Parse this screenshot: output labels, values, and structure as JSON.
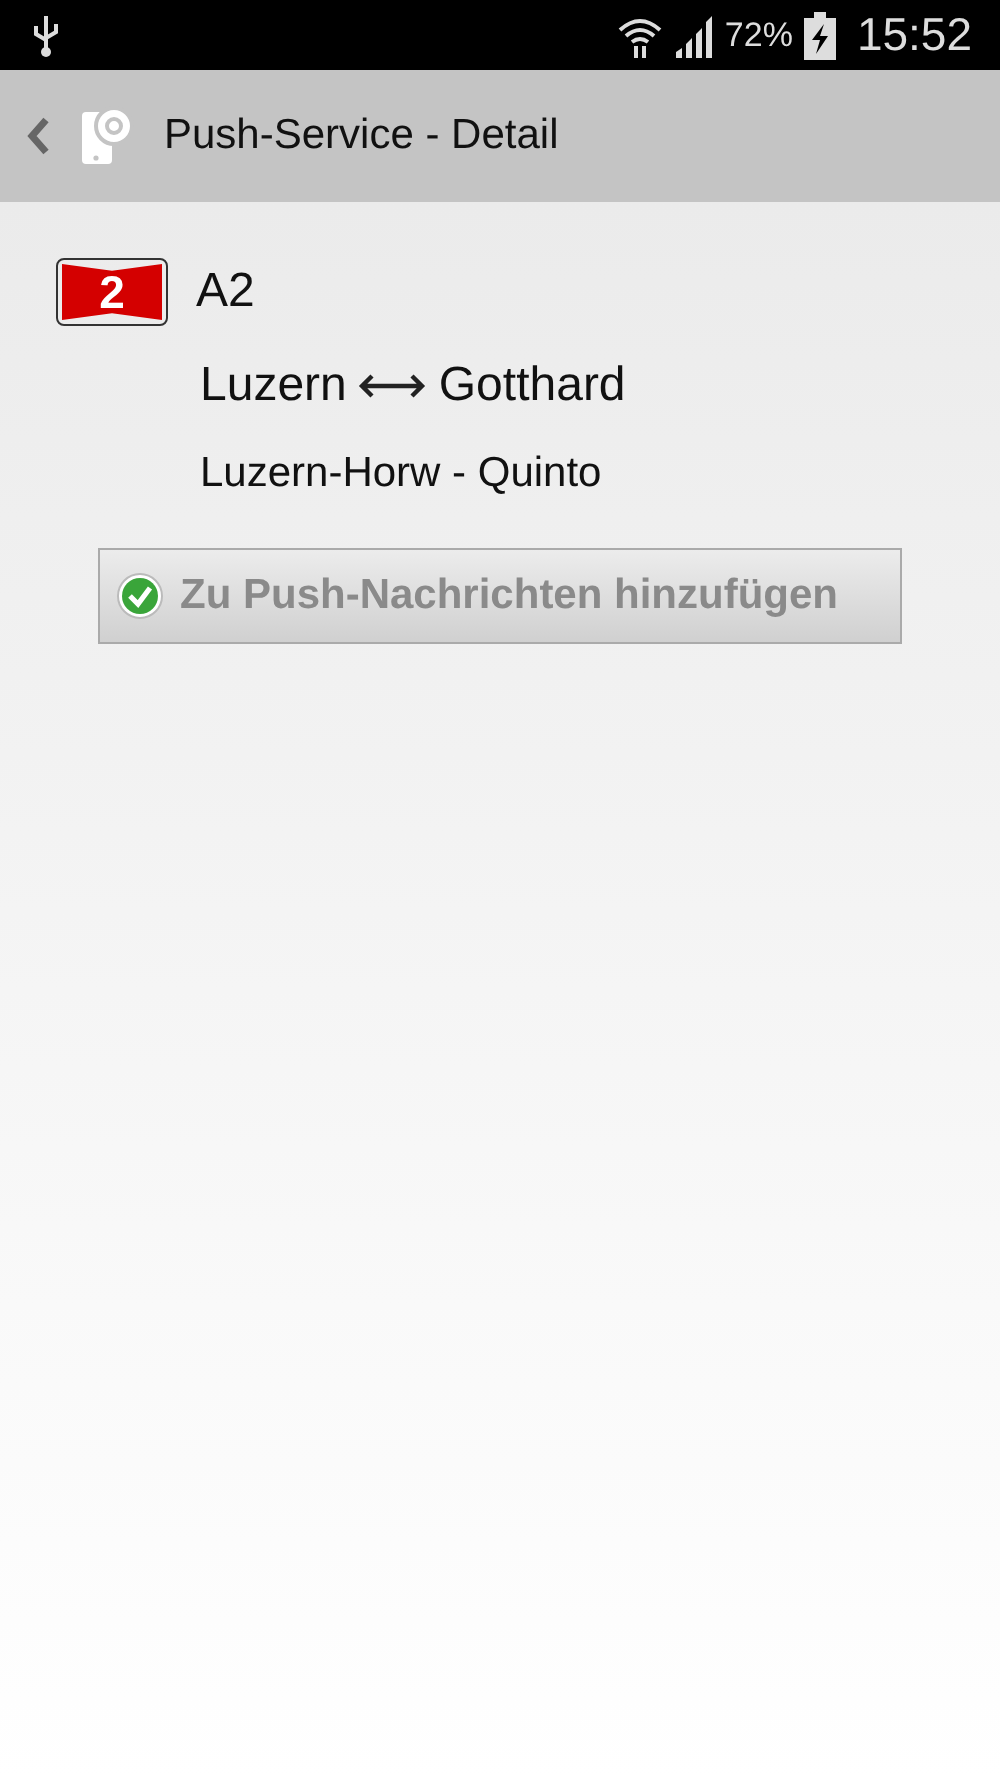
{
  "status_bar": {
    "battery": "72%",
    "time": "15:52"
  },
  "action_bar": {
    "title": "Push-Service - Detail"
  },
  "road": {
    "badge": "2",
    "name": "A2",
    "from": "Luzern",
    "to": "Gotthard",
    "section": "Luzern-Horw - Quinto"
  },
  "button": {
    "label": "Zu Push-Nachrichten hinzufügen",
    "disabled": true
  }
}
